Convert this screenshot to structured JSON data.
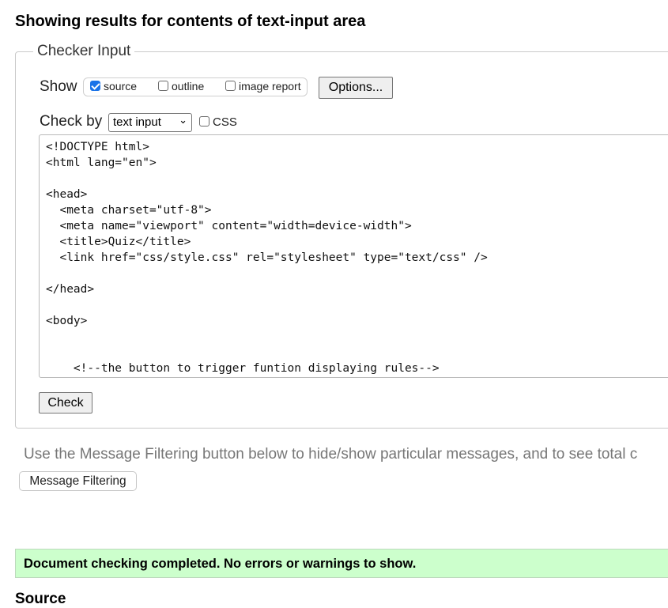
{
  "page": {
    "heading": "Showing results for contents of text-input area"
  },
  "checker": {
    "legend": "Checker Input",
    "show_label": "Show",
    "options": [
      {
        "label": "source",
        "checked": true
      },
      {
        "label": "outline",
        "checked": false
      },
      {
        "label": "image report",
        "checked": false
      }
    ],
    "options_button": "Options...",
    "check_by_label": "Check by",
    "check_by_value": "text input",
    "css_label": "CSS",
    "css_checked": false,
    "textarea_value": "<!DOCTYPE html>\n<html lang=\"en\">\n\n<head>\n  <meta charset=\"utf-8\">\n  <meta name=\"viewport\" content=\"width=device-width\">\n  <title>Quiz</title>\n  <link href=\"css/style.css\" rel=\"stylesheet\" type=\"text/css\" />\n\n</head>\n\n<body>\n\n\n    <!--the button to trigger funtion displaying rules-->",
    "check_button": "Check"
  },
  "filtering": {
    "text": "Use the Message Filtering button below to hide/show particular messages, and to see total c",
    "button": "Message Filtering"
  },
  "result": {
    "message": "Document checking completed. No errors or warnings to show."
  },
  "source": {
    "heading": "Source"
  },
  "colors": {
    "success_bg": "#ccffcc",
    "checkbox_accent": "#1a73e8"
  }
}
